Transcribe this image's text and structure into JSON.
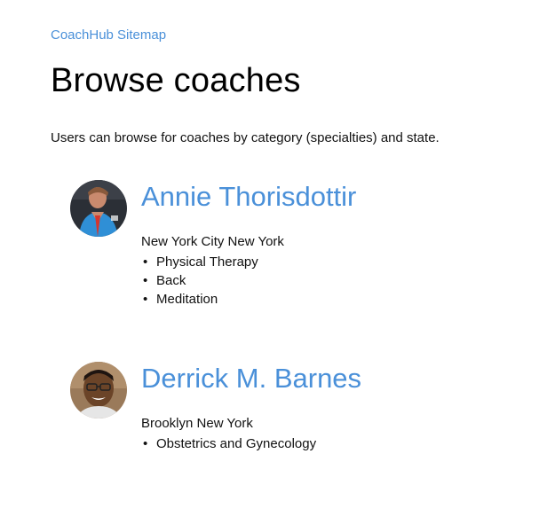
{
  "header": {
    "sitemap_link": "CoachHub Sitemap",
    "title": "Browse coaches",
    "description": "Users can browse for coaches by category (specialties) and state."
  },
  "coaches": [
    {
      "name": "Annie Thorisdottir",
      "location": "New York City New York",
      "specialties": [
        "Physical Therapy",
        "Back",
        "Meditation"
      ]
    },
    {
      "name": "Derrick M. Barnes",
      "location": "Brooklyn New York",
      "specialties": [
        "Obstetrics and Gynecology"
      ]
    }
  ],
  "colors": {
    "link": "#4a90d9",
    "text": "#111111",
    "background": "#ffffff"
  },
  "icons": {
    "coach_1_avatar": "avatar-photo",
    "coach_2_avatar": "avatar-photo"
  }
}
